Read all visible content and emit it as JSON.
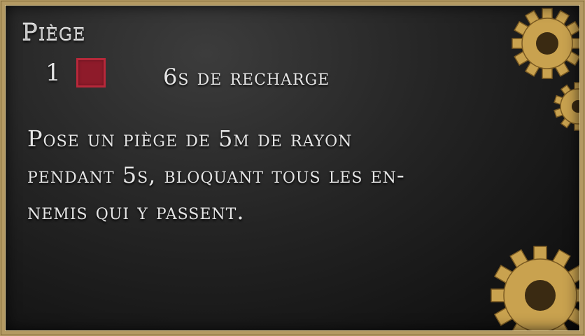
{
  "card": {
    "title": "Piège",
    "cost": "1",
    "cooldown": "6s de recharge",
    "description_lines": [
      "Pose un piège de 5m de rayon",
      "pendant 5s, bloquant tous les en-",
      "nemis qui y passent."
    ]
  },
  "colors": {
    "energy_fill": "#8e1b2a",
    "energy_border": "#b8283a",
    "frame": "#b49a63",
    "gear": "#c9a24f"
  },
  "icons": {
    "energy": "red-square-icon",
    "decor": "gear-icon"
  }
}
